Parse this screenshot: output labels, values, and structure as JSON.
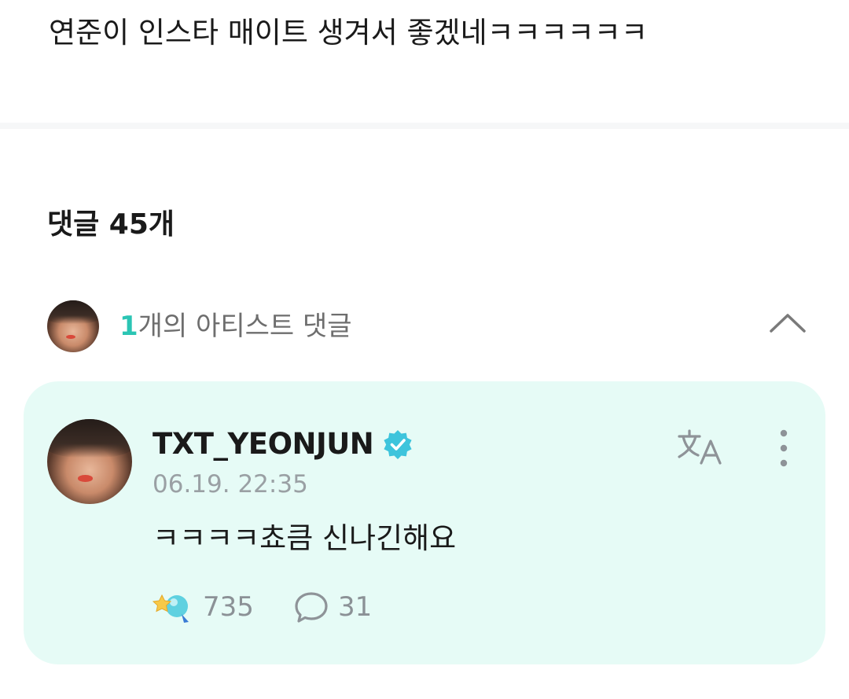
{
  "post": {
    "text": "연준이 인스타 매이트 생겨서 좋겠네ㅋㅋㅋㅋㅋㅋ"
  },
  "comments": {
    "count_label": "댓글 45개"
  },
  "artist_comments": {
    "count": "1",
    "label": "개의 아티스트 댓글"
  },
  "comment": {
    "username": "TXT_YEONJUN",
    "timestamp": "06.19. 22:35",
    "text": "ㅋㅋㅋㅋ쵸큼 신나긴해요",
    "likes": "735",
    "replies": "31"
  },
  "icons": {
    "verified": "verified-badge-icon",
    "translate": "translate-icon",
    "more": "more-vertical-icon",
    "collapse": "chevron-up-icon",
    "like": "like-reaction-icon",
    "reply": "reply-bubble-icon"
  },
  "colors": {
    "accent": "#2bc5b4",
    "card_background": "#e6fbf6",
    "verified": "#3dc4dc",
    "muted_text": "#9aa0a4"
  }
}
